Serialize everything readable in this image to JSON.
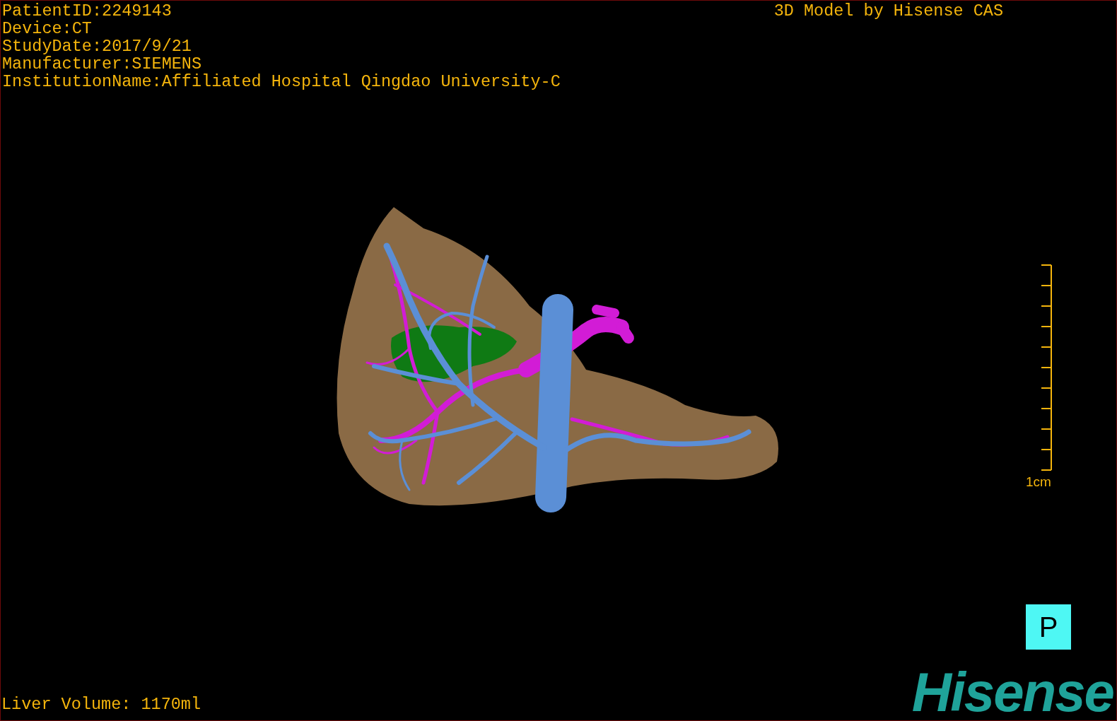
{
  "overlay_info": [
    "PatientID:2249143",
    "Device:CT",
    "StudyDate:2017/9/21",
    "Manufacturer:SIEMENS",
    "InstitutionName:Affiliated Hospital Qingdao University-C"
  ],
  "title": "3D Model by Hisense CAS",
  "scale_bar": {
    "label": "1cm"
  },
  "orientation_marker": "P",
  "liver_volume": "Liver Volume: 1170ml",
  "logo": "Hisense"
}
